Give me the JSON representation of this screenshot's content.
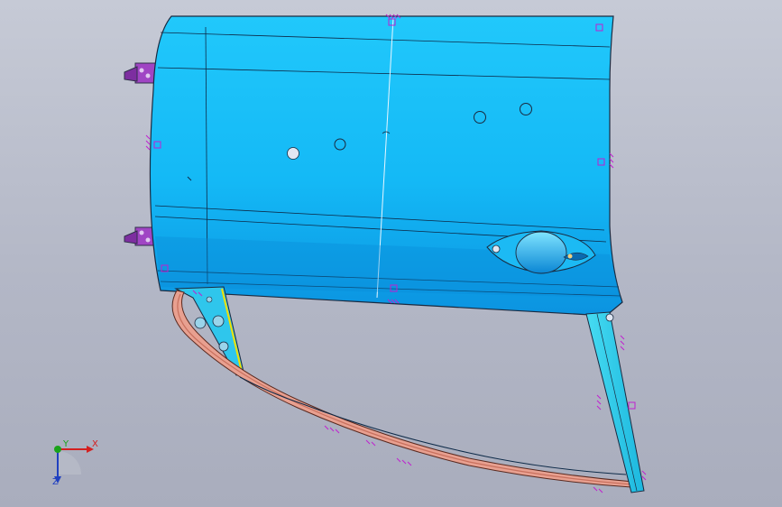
{
  "viewport": {
    "background_top": "#c6cad6",
    "background_bottom": "#a9adbd"
  },
  "model": {
    "body_color": "#16c0f8",
    "body_dark": "#0b8fde",
    "edge_color": "#1a2a40",
    "seal_color": "#e8a090",
    "frame_color": "#2fd0ee",
    "constraint_color": "#c020d0",
    "hinge_color": "#a040c0"
  },
  "axis_triad": {
    "x_label": "X",
    "y_label": "Y",
    "z_label": "Z",
    "x_color": "#d42020",
    "y_color": "#1aa31a",
    "z_color": "#2040c0"
  }
}
